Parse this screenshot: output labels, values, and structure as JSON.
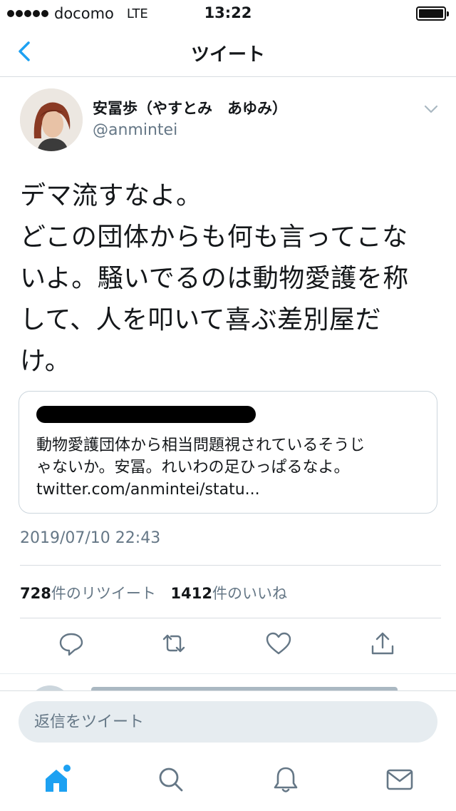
{
  "status_bar": {
    "carrier": "docomo",
    "network": "LTE",
    "time": "13:22"
  },
  "nav": {
    "title": "ツイート",
    "back_icon": "chevron-left-icon"
  },
  "tweet": {
    "display_name": "安冨歩（やすとみ　あゆみ）",
    "handle": "@anmintei",
    "text": "デマ流すなよ。\nどこの団体からも何も言ってこな\nいよ。騒いでるのは動物愛護を称\nして、人を叩いて喜ぶ差別屋だ\nけ。",
    "quote": {
      "text": "動物愛護団体から相当問題視されているそうじ\nゃないか。安冨。れいわの足ひっぱるなよ。\ntwitter.com/anmintei/statu..."
    },
    "timestamp": "2019/07/10 22:43",
    "retweets": {
      "count": "728",
      "label": "件のリツイート"
    },
    "likes": {
      "count": "1412",
      "label": "件のいいね"
    }
  },
  "compose": {
    "placeholder": "返信をツイート"
  },
  "colors": {
    "accent": "#1da1f2",
    "secondary_text": "#657786",
    "divider": "#d8dde1",
    "icon_gray": "#657786"
  },
  "icons": {
    "reply": "reply-icon",
    "retweet": "retweet-icon",
    "like": "heart-icon",
    "share": "share-icon",
    "home": "home-icon",
    "search": "search-icon",
    "notifications": "bell-icon",
    "messages": "mail-icon"
  }
}
